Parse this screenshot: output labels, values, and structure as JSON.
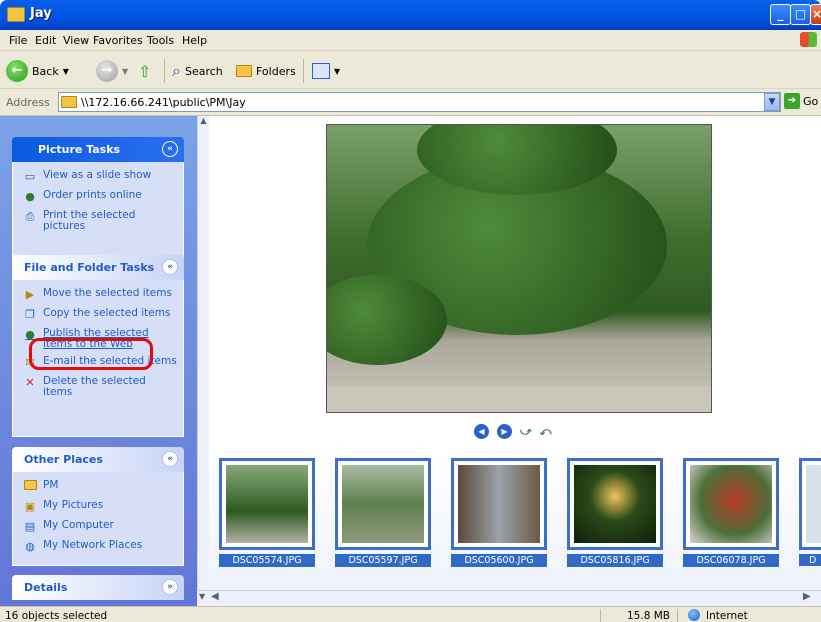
{
  "window": {
    "title": "Jay"
  },
  "menu": [
    "File",
    "Edit",
    "View",
    "Favorites",
    "Tools",
    "Help"
  ],
  "toolbar": {
    "back": "Back",
    "search": "Search",
    "folders": "Folders"
  },
  "address": {
    "label": "Address",
    "value": "\\\\172.16.66.241\\public\\PM\\Jay",
    "go": "Go"
  },
  "picture_tasks": {
    "title": "Picture Tasks",
    "items": [
      "View as a slide show",
      "Order prints online",
      "Print the selected pictures"
    ]
  },
  "file_tasks": {
    "title": "File and Folder Tasks",
    "items": [
      "Move the selected items",
      "Copy the selected items",
      "Publish the selected items to the Web",
      "E-mail the selected items",
      "Delete the selected items"
    ]
  },
  "other_places": {
    "title": "Other Places",
    "items": [
      "PM",
      "My Pictures",
      "My Computer",
      "My Network Places"
    ]
  },
  "details": {
    "title": "Details"
  },
  "thumbnails": [
    "DSC05574.JPG",
    "DSC05597.JPG",
    "DSC05600.JPG",
    "DSC05816.JPG",
    "DSC06078.JPG",
    "D"
  ],
  "status": {
    "left": "16 objects selected",
    "size": "15.8 MB",
    "zone": "Internet"
  }
}
